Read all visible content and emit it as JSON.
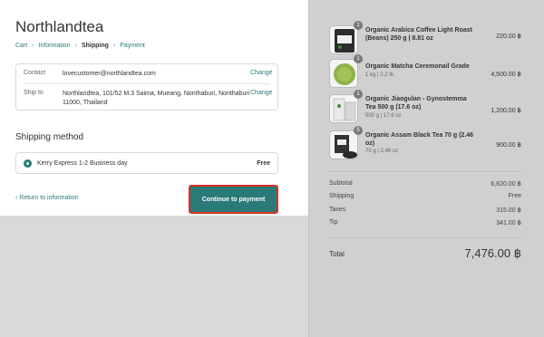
{
  "shop": {
    "name": "Northlandtea"
  },
  "breadcrumb": [
    "Cart",
    "Information",
    "Shipping",
    "Payment"
  ],
  "contact": {
    "label": "Contact",
    "value": "lovecustomer@northlandtea.com",
    "change": "Change"
  },
  "ship_to": {
    "label": "Ship to",
    "value": "Northlandtea, 101/52 M.3 Saima, Mueang, Nonthaburi, Nonthaburi 11000, Thailand",
    "change": "Change"
  },
  "shipping_method": {
    "heading": "Shipping method",
    "option": "Kerry Express 1-2 Business day",
    "price": "Free"
  },
  "actions": {
    "return": "Return to information",
    "continue": "Continue to payment"
  },
  "items": [
    {
      "qty": "1",
      "name": "Organic Arabica Coffee Light Roast (Beans) 250 g | 8.81 oz",
      "sub": "",
      "price": "220.00 ฿"
    },
    {
      "qty": "1",
      "name": "Organic Matcha Ceremonail Grade",
      "sub": "1 kg | 2.2 lb",
      "price": "4,500.00 ฿"
    },
    {
      "qty": "1",
      "name": "Organic Jiaogulan - Gynostemma Tea 500 g (17.6 oz)",
      "sub": "500 g | 17.6 oz",
      "price": "1,200.00 ฿"
    },
    {
      "qty": "5",
      "name": "Organic Assam Black Tea 70 g (2.46 oz)",
      "sub": "70 g | 2.46 oz",
      "price": "900.00 ฿"
    }
  ],
  "totals": {
    "subtotal": {
      "label": "Subtotal",
      "value": "6,820.00 ฿"
    },
    "shipping": {
      "label": "Shipping",
      "value": "Free"
    },
    "taxes": {
      "label": "Taxes",
      "value": "315.00 ฿"
    },
    "tip": {
      "label": "Tip",
      "value": "341.00 ฿"
    },
    "total": {
      "label": "Total",
      "value": "7,476.00 ฿"
    }
  }
}
